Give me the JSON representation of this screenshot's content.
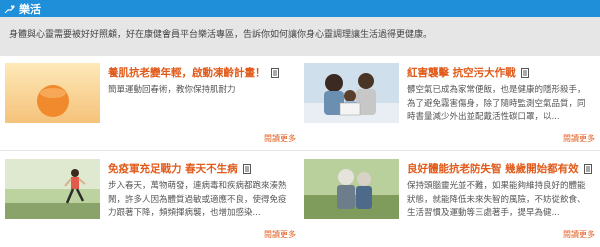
{
  "header": {
    "title": "樂活",
    "icon": "heart-hand-icon"
  },
  "intro": {
    "text": "身體與心靈需要被好好照顧，好在康健會員平台樂活專區，告訴你如何讓你身心靈調理讓生活過得更健康。"
  },
  "cards": [
    {
      "title": "養肌抗老變年輕，啟動凍齡計畫！",
      "desc": "簡單運動回春術，教你保持肌耐力",
      "more": "閱讀更多"
    },
    {
      "title": "紅害襲擊 抗空污大作戰",
      "desc": "髒空氣已成為家常便飯，也是健康的隱形殺手，為了避免霧害傷身，除了隨時監測空氣品質，同時書量減少外出並配戴活性碳口罩，以...",
      "more": "閱讀更多"
    },
    {
      "title": "免疫軍充足戰力 春天不生病",
      "desc": "步入春天，萬物萌發，連病毒和疾病都跑來湊熱鬧，許多人因為體質過敏或適應不良，使得免疫力跟著下降，頻頻揮病襲，也增加感染...",
      "more": "閱讀更多"
    },
    {
      "title": "良好體能抗老防失智 幾歲開始都有效",
      "desc": "保持頭腦靈光並不難，如果能夠維持良好的體能狀態，就能降低未來失智的風險，不妨從飲食、生活習慣及運動等三處著手，提早為健...",
      "more": "閱讀更多"
    }
  ]
}
